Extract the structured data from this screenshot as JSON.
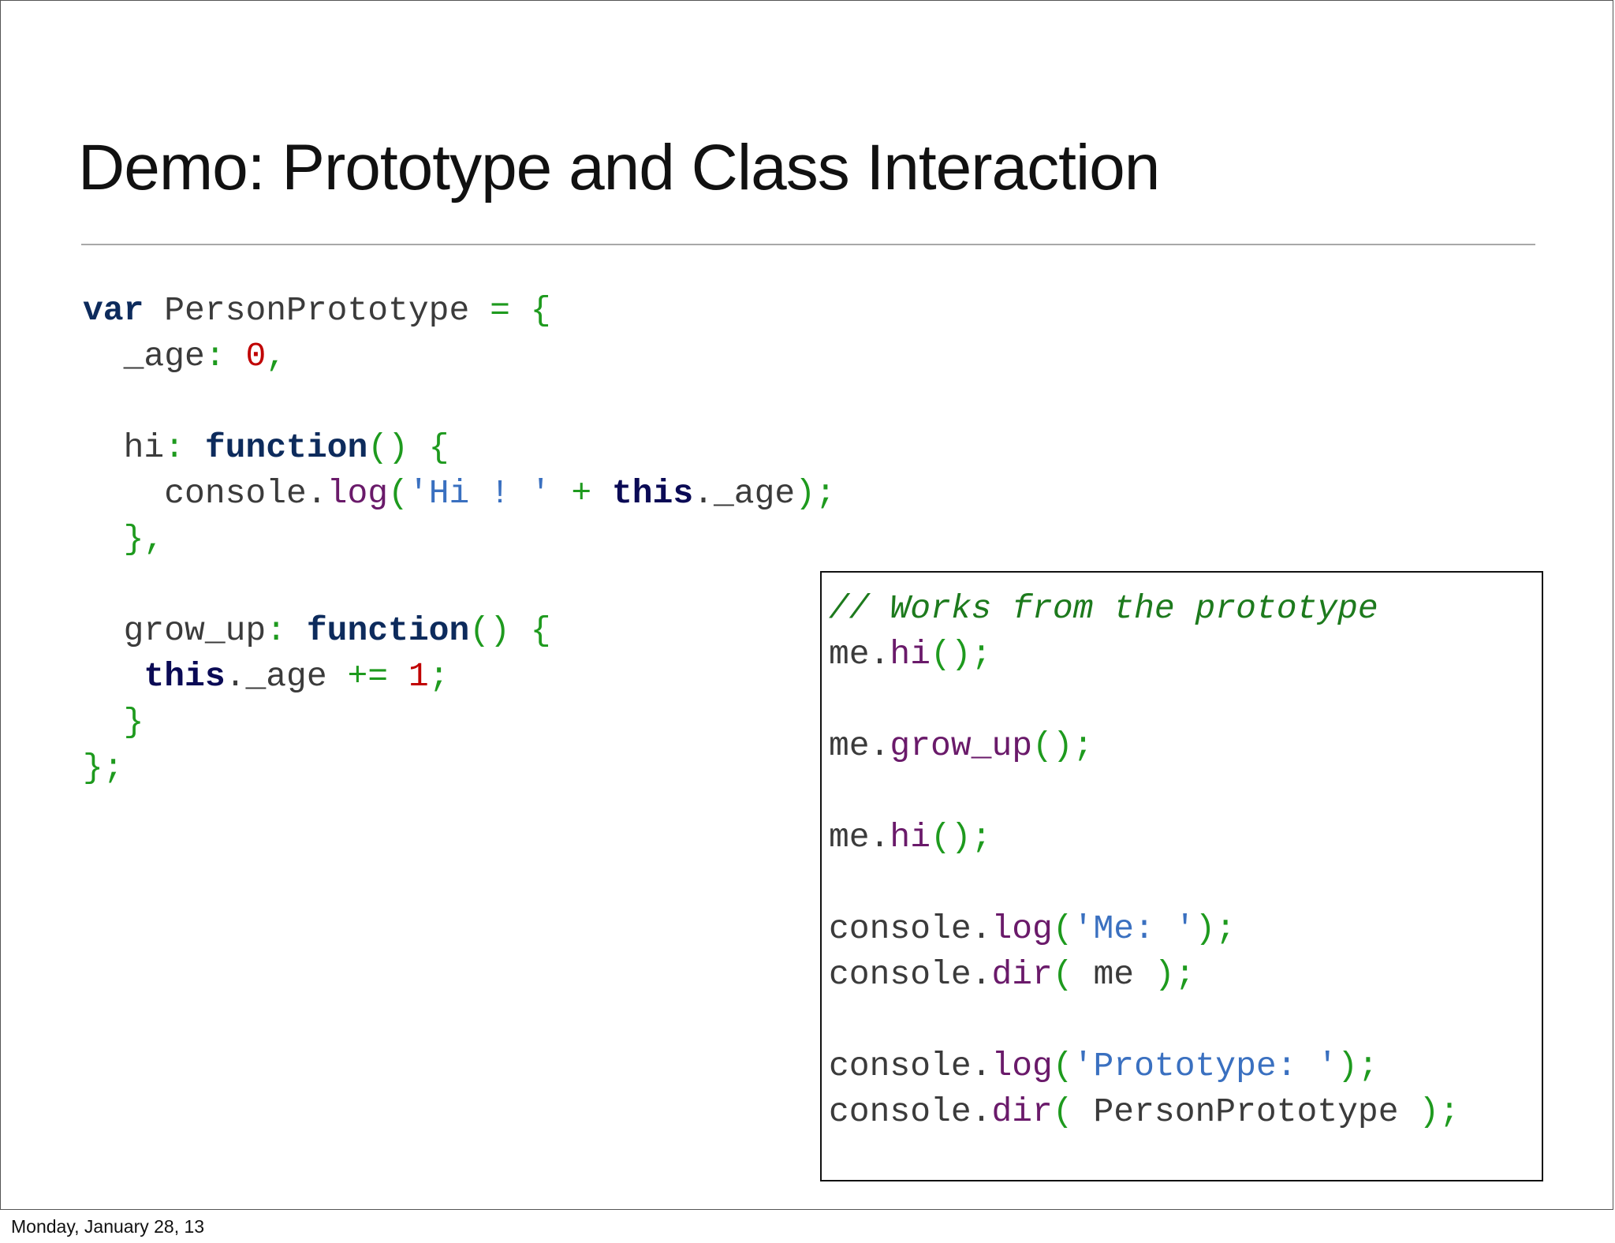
{
  "slide": {
    "title": "Demo: Prototype and Class Interaction",
    "footer_date": "Monday, January 28, 13"
  },
  "colors": {
    "keyword": "#0d2b5c",
    "punctuation": "#1e9a1e",
    "number": "#c00000",
    "string": "#3a70c0",
    "method": "#6a1a6a",
    "comment": "#1d7a1d"
  },
  "code_main": {
    "l1": {
      "kw": "var",
      "name": " PersonPrototype ",
      "op": "= {"
    },
    "l2": {
      "indent": "  ",
      "prop": "_age",
      "colon": ": ",
      "num": "0",
      "comma": ","
    },
    "l4": {
      "indent": "  ",
      "prop": "hi",
      "colon": ": ",
      "kw": "function",
      "paren": "() {"
    },
    "l5": {
      "indent": "    ",
      "obj": "console.",
      "fn": "log",
      "open": "(",
      "str": "'Hi ! '",
      "plus": " + ",
      "kw": "this",
      "rest": "._age",
      "close": ");"
    },
    "l6": {
      "indent": "  ",
      "close": "},"
    },
    "l8": {
      "indent": "  ",
      "prop": "grow_up",
      "colon": ": ",
      "kw": "function",
      "paren": "() {"
    },
    "l9": {
      "indent": "   ",
      "kw": "this",
      "rest": "._age ",
      "op": "+=",
      "sp": " ",
      "num": "1",
      "semi": ";"
    },
    "l10": {
      "indent": "  ",
      "close": "}"
    },
    "l11": {
      "close": "};"
    }
  },
  "code_box": {
    "l1": {
      "comment": "// Works from the prototype"
    },
    "l2": {
      "obj": "me.",
      "fn": "hi",
      "paren": "();"
    },
    "l4": {
      "obj": "me.",
      "fn": "grow_up",
      "paren": "();"
    },
    "l6": {
      "obj": "me.",
      "fn": "hi",
      "paren": "();"
    },
    "l8": {
      "obj": "console.",
      "fn": "log",
      "open": "(",
      "str": "'Me: '",
      "close": ");"
    },
    "l9": {
      "obj": "console.",
      "fn": "dir",
      "open": "(",
      "arg": " me ",
      "close": ");"
    },
    "l11": {
      "obj": "console.",
      "fn": "log",
      "open": "(",
      "str": "'Prototype: '",
      "close": ");"
    },
    "l12": {
      "obj": "console.",
      "fn": "dir",
      "open": "(",
      "arg": " PersonPrototype ",
      "close": ");"
    }
  }
}
